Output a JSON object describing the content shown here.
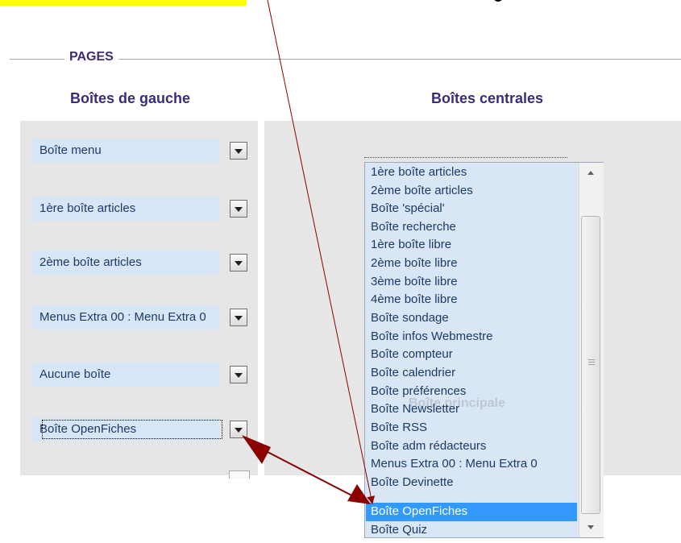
{
  "fieldset": {
    "legend": "PAGES"
  },
  "columns": {
    "left_header": "Boîtes de gauche",
    "center_header": "Boîtes centrales"
  },
  "left_selects": [
    {
      "value": "Boîte menu"
    },
    {
      "value": "1ère boîte articles"
    },
    {
      "value": "2ème boîte articles"
    },
    {
      "value": "Menus Extra 00 : Menu Extra 0"
    },
    {
      "value": "Aucune boîte"
    },
    {
      "value": "Boîte OpenFiches"
    }
  ],
  "center_listbox": {
    "watermark": "Boîte principale",
    "selected": "Boîte OpenFiches",
    "options": [
      "1ère boîte articles",
      "2ème boîte articles",
      "Boîte 'spécial'",
      "Boîte recherche",
      "1ère boîte libre",
      "2ème boîte libre",
      "3ème boîte libre",
      "4ème boîte libre",
      "Boîte sondage",
      "Boîte infos Webmestre",
      "Boîte compteur",
      "Boîte calendrier",
      "Boîte préférences",
      "Boîte Newsletter",
      "Boîte RSS",
      "Boîte adm rédacteurs",
      "Menus Extra 00 : Menu Extra 0",
      "Boîte Devinette",
      "Boîte OpenFiches",
      "Boîte Quiz"
    ]
  },
  "icons": {
    "dropdown": "chevron-down-icon",
    "scroll_up": "scroll-up-icon",
    "scroll_down": "scroll-down-icon",
    "annotation_arrow": "arrow-icon"
  },
  "colors": {
    "highlight": "#ffff00",
    "heading": "#3b2c78",
    "select_bg": "#d7e6f7",
    "selection": "#3399ff",
    "arrow": "#8b0000"
  }
}
